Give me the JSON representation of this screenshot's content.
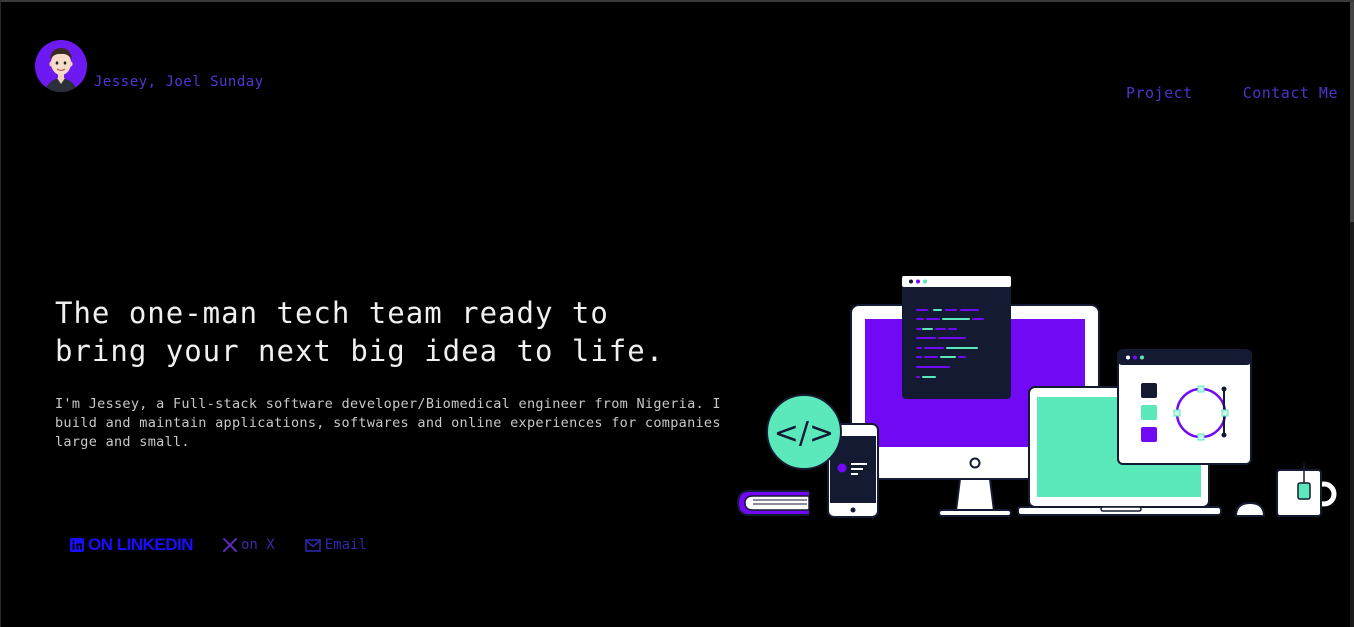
{
  "header": {
    "brand_name": "Jessey, Joel Sunday",
    "nav": [
      {
        "label": "Project"
      },
      {
        "label": "Contact Me"
      }
    ]
  },
  "hero": {
    "headline_line1": "The one-man tech team ready to",
    "headline_line2": "bring your next big idea to life.",
    "intro": "I'm Jessey, a Full-stack software developer/Biomedical engineer from Nigeria. I build and maintain applications, softwares and online experiences for companies large and small."
  },
  "socials": {
    "linkedin_label": "ON LINKEDIN",
    "x_label": "on X",
    "email_label": "Email"
  },
  "illustration": {
    "code_symbol": "</>"
  },
  "colors": {
    "background": "#000000",
    "accent_purple": "#7209f5",
    "accent_mint": "#5be8bb",
    "navy": "#151a33",
    "nav_link": "#4c34c9"
  },
  "icons": [
    "avatar",
    "linkedin-icon",
    "x-icon",
    "email-icon",
    "code-icon"
  ]
}
